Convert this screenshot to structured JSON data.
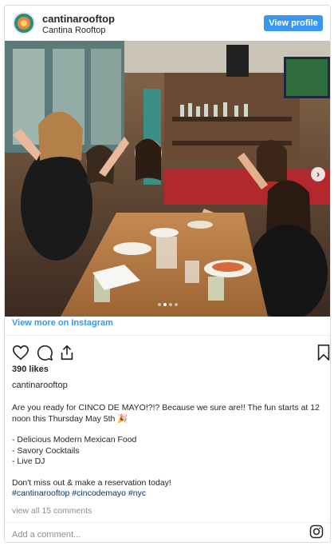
{
  "header": {
    "username": "cantinarooftop",
    "display_name": "Cantina Rooftop",
    "view_profile_label": "View profile"
  },
  "post": {
    "image_description_icon": "carousel-photo",
    "carousel_dots": 4,
    "carousel_active_index": 1,
    "view_more_label": "View more on Instagram",
    "likes_label": "390 likes",
    "account_label": "cantinarooftop",
    "caption_lines": [
      "Are you ready for CINCO DE MAYO!?!? Because we sure are!! The fun starts at 12",
      "noon this Thursday May 5th 🎉"
    ],
    "list_lines": [
      "- Delicious Modern Mexican Food",
      "- Savory Cocktails",
      "- Live DJ"
    ],
    "closing_line": "Don't miss out & make a reservation today!",
    "hashtags": "#cantinarooftop #cincodemayo #nyc",
    "view_comments_label": "view all 15 comments",
    "add_comment_placeholder": "Add a comment..."
  },
  "colors": {
    "accent": "#3897f0",
    "hashtag": "#003569",
    "muted": "#8e8e8e"
  }
}
